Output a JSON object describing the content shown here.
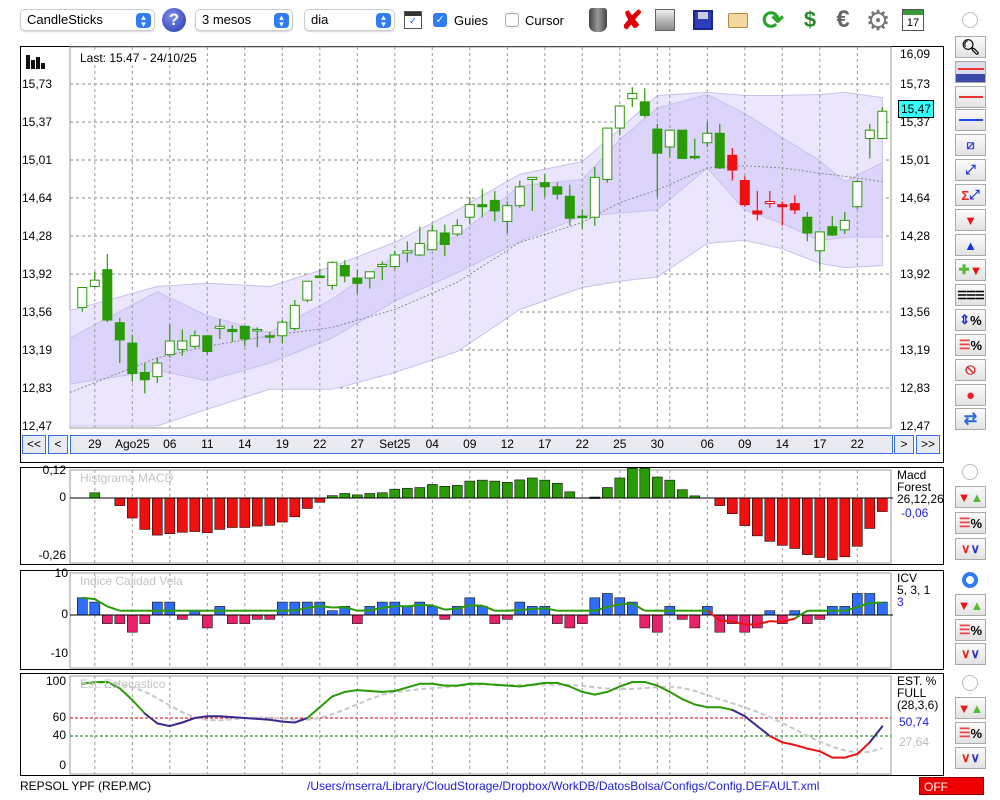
{
  "toolbar": {
    "chart_type": "CandleSticks",
    "period": "3 mesos",
    "interval": "dia",
    "guides_label": "Guies",
    "guides_checked": true,
    "cursor_label": "Cursor",
    "cursor_checked": false,
    "calendar_day": "17",
    "icons": [
      "help-icon",
      "chart-window-icon",
      "trash-icon",
      "delete-icon",
      "print-icon",
      "save-icon",
      "open-folder-icon",
      "refresh-icon",
      "sync-icon",
      "euro-icon",
      "gear-icon",
      "calendar-icon"
    ]
  },
  "main": {
    "last_label": "Last: 15.47 - 24/10/25",
    "y_ticks": [
      "16,09",
      "15,73",
      "15,37",
      "15,01",
      "14,64",
      "14,28",
      "13,92",
      "13,56",
      "13,19",
      "12,83",
      "12,47"
    ],
    "current_price": "15,47",
    "nav": {
      "first": "<<",
      "prev": "<",
      "next": ">",
      "last": ">>"
    },
    "date_labels": [
      {
        "i": 1,
        "t": "29"
      },
      {
        "i": 4,
        "t": "Ago25"
      },
      {
        "i": 7,
        "t": "06"
      },
      {
        "i": 10,
        "t": "11"
      },
      {
        "i": 13,
        "t": "14"
      },
      {
        "i": 16,
        "t": "19"
      },
      {
        "i": 19,
        "t": "22"
      },
      {
        "i": 22,
        "t": "27"
      },
      {
        "i": 25,
        "t": "Set25"
      },
      {
        "i": 28,
        "t": "04"
      },
      {
        "i": 31,
        "t": "09"
      },
      {
        "i": 34,
        "t": "12"
      },
      {
        "i": 37,
        "t": "17"
      },
      {
        "i": 40,
        "t": "22"
      },
      {
        "i": 43,
        "t": "25"
      },
      {
        "i": 46,
        "t": "30"
      },
      {
        "i": 47,
        "t": ""
      },
      {
        "i": 50,
        "t": "06"
      },
      {
        "i": 53,
        "t": "09"
      },
      {
        "i": 56,
        "t": "14"
      },
      {
        "i": 59,
        "t": "17"
      },
      {
        "i": 62,
        "t": "22"
      }
    ]
  },
  "chart_data": [
    {
      "type": "candlestick",
      "title": "Last: 15.47 - 24/10/25",
      "ylim": [
        12.47,
        16.09
      ],
      "candles": [
        [
          13.6,
          13.79,
          13.56,
          13.79
        ],
        [
          13.8,
          13.94,
          13.79,
          13.86
        ],
        [
          13.96,
          14.11,
          13.46,
          13.48
        ],
        [
          13.455,
          13.5,
          13.07,
          13.29
        ],
        [
          13.26,
          13.34,
          12.89,
          12.97
        ],
        [
          12.98,
          13.07,
          12.78,
          12.91
        ],
        [
          12.94,
          13.12,
          12.88,
          13.07
        ],
        [
          13.15,
          13.44,
          13.12,
          13.28
        ],
        [
          13.2,
          13.39,
          13.14,
          13.28
        ],
        [
          13.23,
          13.38,
          13.21,
          13.33
        ],
        [
          13.33,
          13.33,
          13.15,
          13.18
        ],
        [
          13.4,
          13.49,
          13.3,
          13.42
        ],
        [
          13.39,
          13.43,
          13.27,
          13.37
        ],
        [
          13.42,
          13.42,
          13.23,
          13.3
        ],
        [
          13.385,
          13.41,
          13.22,
          13.39
        ],
        [
          13.33,
          13.37,
          13.26,
          13.33
        ],
        [
          13.33,
          13.48,
          13.26,
          13.46
        ],
        [
          13.4,
          13.67,
          13.38,
          13.62
        ],
        [
          13.67,
          13.85,
          13.65,
          13.85
        ],
        [
          13.9,
          13.97,
          13.88,
          13.885
        ],
        [
          13.81,
          14.04,
          13.77,
          14.03
        ],
        [
          14.0,
          14.05,
          13.84,
          13.9
        ],
        [
          13.88,
          13.96,
          13.73,
          13.83
        ],
        [
          13.88,
          13.94,
          13.78,
          13.94
        ],
        [
          13.99,
          14.04,
          13.86,
          14.01
        ],
        [
          13.99,
          14.14,
          13.96,
          14.1
        ],
        [
          14.12,
          14.23,
          14.03,
          14.14
        ],
        [
          14.1,
          14.37,
          14.09,
          14.21
        ],
        [
          14.15,
          14.39,
          14.15,
          14.33
        ],
        [
          14.31,
          14.39,
          14.09,
          14.2
        ],
        [
          14.3,
          14.44,
          14.28,
          14.38
        ],
        [
          14.46,
          14.65,
          14.39,
          14.58
        ],
        [
          14.58,
          14.73,
          14.46,
          14.56
        ],
        [
          14.62,
          14.71,
          14.42,
          14.52
        ],
        [
          14.42,
          14.61,
          14.31,
          14.57
        ],
        [
          14.57,
          14.81,
          14.55,
          14.75
        ],
        [
          14.82,
          14.84,
          14.52,
          14.84
        ],
        [
          14.79,
          14.87,
          14.65,
          14.75
        ],
        [
          14.75,
          14.79,
          14.63,
          14.68
        ],
        [
          14.66,
          14.77,
          14.38,
          14.45
        ],
        [
          14.47,
          14.53,
          14.35,
          14.46
        ],
        [
          14.46,
          14.94,
          14.38,
          14.84
        ],
        [
          14.82,
          15.31,
          14.79,
          15.31
        ],
        [
          15.31,
          15.53,
          15.24,
          15.52
        ],
        [
          15.59,
          15.7,
          15.51,
          15.64
        ],
        [
          15.56,
          15.69,
          15.41,
          15.43
        ],
        [
          15.3,
          15.35,
          14.65,
          15.07
        ],
        [
          15.13,
          15.29,
          15.03,
          15.29
        ],
        [
          15.29,
          15.29,
          15.02,
          15.02
        ],
        [
          15.04,
          15.21,
          15.01,
          15.04
        ],
        [
          15.17,
          15.37,
          15.13,
          15.26
        ],
        [
          15.26,
          15.35,
          14.92,
          14.93
        ],
        [
          15.05,
          15.12,
          14.81,
          14.91
        ],
        [
          14.81,
          14.85,
          14.56,
          14.58
        ],
        [
          14.52,
          14.71,
          14.43,
          14.49
        ],
        [
          14.59,
          14.71,
          14.55,
          14.61
        ],
        [
          14.58,
          14.61,
          14.38,
          14.56
        ],
        [
          14.59,
          14.67,
          14.49,
          14.53
        ],
        [
          14.46,
          14.51,
          14.23,
          14.31
        ],
        [
          14.14,
          14.32,
          13.95,
          14.32
        ],
        [
          14.37,
          14.47,
          14.28,
          14.29
        ],
        [
          14.34,
          14.51,
          14.3,
          14.43
        ],
        [
          14.56,
          14.81,
          14.54,
          14.8
        ],
        [
          15.21,
          15.35,
          15.02,
          15.29
        ],
        [
          15.21,
          15.51,
          15.21,
          15.47
        ]
      ],
      "red_candles": [
        52,
        53,
        54,
        55,
        56,
        57
      ],
      "band_index": [
        -1,
        6,
        10,
        15,
        20,
        25,
        30,
        35,
        40,
        43,
        46,
        50,
        53,
        56,
        59,
        61,
        64
      ],
      "outer_upper": [
        13.57,
        13.8,
        13.83,
        13.8,
        13.99,
        14.22,
        14.53,
        14.87,
        14.99,
        15.3,
        15.62,
        15.65,
        15.62,
        15.62,
        15.63,
        15.65,
        15.6
      ],
      "inner_upper": [
        13.31,
        13.75,
        13.52,
        13.36,
        13.68,
        14.09,
        14.28,
        14.76,
        14.82,
        15.2,
        15.5,
        15.63,
        15.45,
        15.22,
        15.0,
        14.8,
        14.98
      ],
      "inner_lower": [
        12.87,
        13.0,
        12.9,
        13.07,
        13.31,
        13.66,
        13.93,
        14.23,
        14.47,
        14.5,
        14.53,
        14.93,
        14.53,
        14.4,
        14.24,
        14.27,
        14.27
      ],
      "outer_lower": [
        12.47,
        12.47,
        12.63,
        12.82,
        12.82,
        12.98,
        13.18,
        13.58,
        13.79,
        13.85,
        13.89,
        14.21,
        14.24,
        14.16,
        14.02,
        13.98,
        14.0
      ],
      "moving_average": [
        12.79,
        13.12,
        13.23,
        13.33,
        13.41,
        13.58,
        13.84,
        14.22,
        14.41,
        14.6,
        14.72,
        14.93,
        14.95,
        14.93,
        14.88,
        14.85,
        14.8
      ]
    },
    {
      "type": "bar",
      "title": "Histgrama MACD",
      "y_ticks": [
        "0,12",
        "0",
        "-0,26"
      ],
      "ylim": [
        -0.27,
        0.13
      ],
      "values": [
        0,
        0.022,
        0,
        -0.032,
        -0.084,
        -0.132,
        -0.156,
        -0.15,
        -0.144,
        -0.141,
        -0.146,
        -0.132,
        -0.124,
        -0.124,
        -0.118,
        -0.115,
        -0.101,
        -0.079,
        -0.044,
        -0.018,
        0.01,
        0.019,
        0.013,
        0.019,
        0.022,
        0.037,
        0.041,
        0.044,
        0.057,
        0.049,
        0.053,
        0.071,
        0.075,
        0.071,
        0.066,
        0.076,
        0.084,
        0.075,
        0.062,
        0.026,
        0,
        0.004,
        0.044,
        0.084,
        0.125,
        0.125,
        0.088,
        0.075,
        0.035,
        0.009,
        0,
        -0.032,
        -0.066,
        -0.116,
        -0.159,
        -0.182,
        -0.199,
        -0.212,
        -0.238,
        -0.25,
        -0.26,
        -0.247,
        -0.203,
        -0.128,
        -0.057
      ],
      "legend": [
        "Macd",
        "Forest",
        "26,12,26"
      ],
      "last_value": "-0,06"
    },
    {
      "type": "bar",
      "title": "Indice Calidad Vela",
      "y_ticks": [
        "10",
        "0",
        "-10"
      ],
      "ylim": [
        -10,
        10
      ],
      "values": [
        4,
        3,
        -2,
        -2,
        -4,
        -2,
        3,
        3,
        -1,
        1,
        -3,
        2,
        -2,
        -2,
        -1,
        -1,
        3,
        3,
        3,
        3,
        1,
        2,
        -2,
        2,
        3,
        3,
        2,
        3,
        2,
        -1,
        2,
        4,
        2,
        -2,
        -1,
        3,
        2,
        2,
        -2,
        -3,
        -2,
        4,
        5,
        4,
        3,
        -3,
        -4,
        2,
        -1,
        -3,
        2,
        -4,
        -2,
        -4,
        -3,
        1,
        -2,
        1,
        -2,
        -1,
        2,
        2,
        5,
        5,
        3
      ],
      "legend": [
        "ICV",
        "5, 3, 1"
      ],
      "last_value": "3"
    },
    {
      "type": "line",
      "title": "Est. Estocastico",
      "y_ticks": [
        "100",
        "60",
        "40",
        "0"
      ],
      "ylim": [
        0,
        100
      ],
      "levels": [
        60,
        40
      ],
      "k_values": [
        98,
        100,
        100,
        93,
        80,
        65,
        54,
        51,
        55,
        60,
        62,
        62,
        61,
        60,
        59,
        58,
        56,
        55,
        60,
        72,
        84,
        89,
        91,
        90,
        89,
        90,
        94,
        98,
        98,
        96,
        96,
        98,
        98,
        97,
        96,
        95,
        97,
        99,
        99,
        95,
        89,
        86,
        89,
        95,
        100,
        100,
        96,
        89,
        81,
        75,
        72,
        72,
        69,
        62,
        51,
        40,
        33,
        30,
        26,
        23,
        16,
        16,
        20,
        33,
        50.74
      ],
      "d_period": 6,
      "legend": [
        "EST. %",
        "FULL",
        "(28,3,6)"
      ],
      "last_k": "50,74",
      "last_d": "27,64"
    }
  ],
  "status": {
    "symbol": "REPSOL YPF (REP.MC)",
    "path": "/Users/mserra/Library/CloudStorage/Dropbox/WorkDB/DatosBolsa/Configs/Config.DEFAULT.xml",
    "off_label": "OFF"
  },
  "colors": {
    "green": "#2a9a06",
    "red": "#ee1111",
    "blue": "#2f6df6",
    "pink": "#e8226a",
    "band_outer": "#ebe6fd",
    "band_inner": "#ddd4fb",
    "navy": "#3a2a8f"
  }
}
